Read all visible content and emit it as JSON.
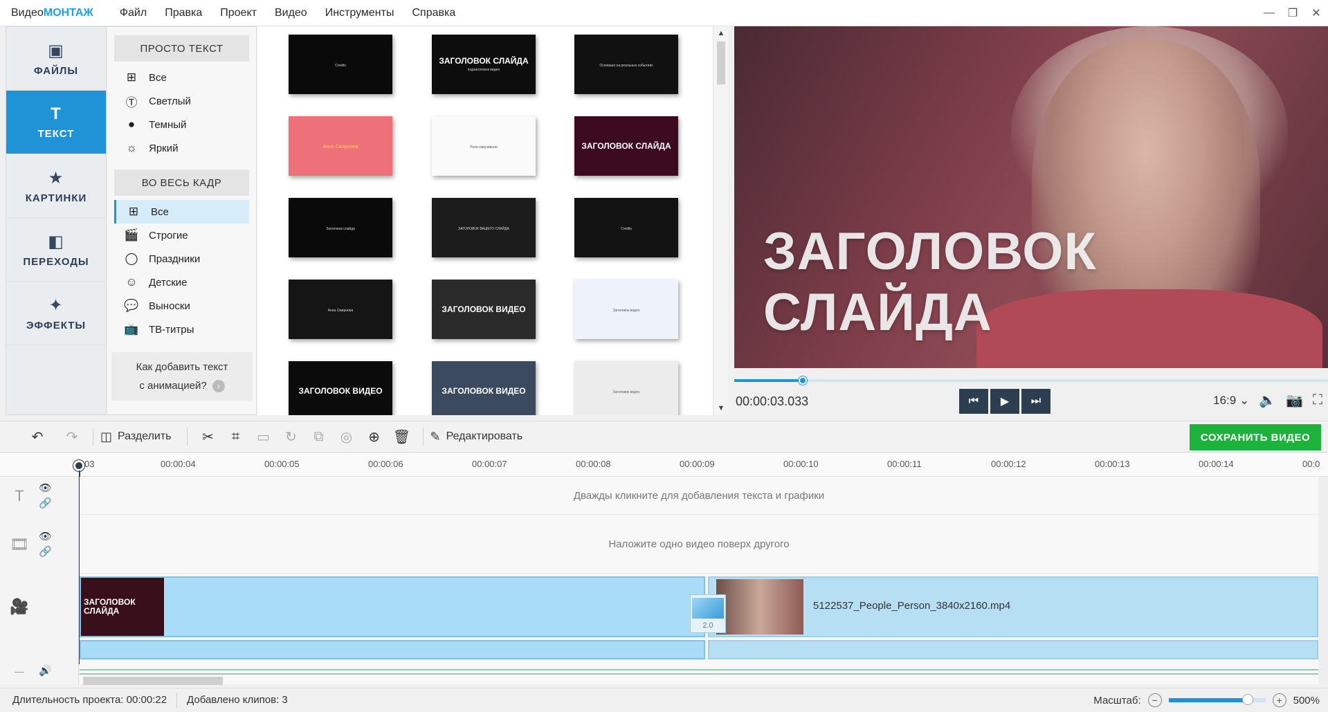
{
  "app": {
    "logo_plain": "Видео",
    "logo_bold": "МОНТАЖ"
  },
  "menu": [
    "Файл",
    "Правка",
    "Проект",
    "Видео",
    "Инструменты",
    "Справка"
  ],
  "window_controls": {
    "minimize": "—",
    "restore": "❐",
    "close": "✕"
  },
  "leftnav": [
    {
      "label": "ФАЙЛЫ",
      "icon": "image-icon",
      "glyph": "▣",
      "active": false
    },
    {
      "label": "ТЕКСТ",
      "icon": "text-icon",
      "glyph": "T",
      "active": true
    },
    {
      "label": "КАРТИНКИ",
      "icon": "star-icon",
      "glyph": "★",
      "active": false
    },
    {
      "label": "ПЕРЕХОДЫ",
      "icon": "transitions-icon",
      "glyph": "◧",
      "active": false
    },
    {
      "label": "ЭФФЕКТЫ",
      "icon": "magic-wand-icon",
      "glyph": "✦",
      "active": false
    }
  ],
  "categories": {
    "group1_title": "ПРОСТО ТЕКСТ",
    "group1": [
      {
        "label": "Все",
        "icon": "grid-icon",
        "glyph": "⊞"
      },
      {
        "label": "Светлый",
        "icon": "text-circle-light-icon",
        "glyph": "Ⓣ"
      },
      {
        "label": "Темный",
        "icon": "text-circle-dark-icon",
        "glyph": "●"
      },
      {
        "label": "Яркий",
        "icon": "sun-icon",
        "glyph": "☼"
      }
    ],
    "group2_title": "ВО ВЕСЬ КАДР",
    "group2": [
      {
        "label": "Все",
        "icon": "grid-icon",
        "glyph": "⊞",
        "selected": true
      },
      {
        "label": "Строгие",
        "icon": "clapper-icon",
        "glyph": "🎬"
      },
      {
        "label": "Праздники",
        "icon": "balloon-icon",
        "glyph": "◯"
      },
      {
        "label": "Детские",
        "icon": "smiley-icon",
        "glyph": "☺"
      },
      {
        "label": "Выноски",
        "icon": "speech-bubble-icon",
        "glyph": "💬"
      },
      {
        "label": "ТВ-титры",
        "icon": "tv-icon",
        "glyph": "📺"
      }
    ],
    "help_line1": "Как добавить текст",
    "help_line2": "с анимацией?"
  },
  "thumbnails": [
    {
      "title": "",
      "sub": "Credits",
      "bg": "#0a0a0a"
    },
    {
      "title": "ЗАГОЛОВОК СЛАЙДА",
      "sub": "подзаголовок видео",
      "bg": "#0d0d0d"
    },
    {
      "title": "",
      "sub": "Основано на реальных событиях",
      "bg": "#111111"
    },
    {
      "title": "",
      "sub": "Анна Смирнова",
      "bg": "#ee7079"
    },
    {
      "title": "",
      "sub": "Роли озвучивали",
      "bg": "#fafafa"
    },
    {
      "title": "ЗАГОЛОВОК СЛАЙДА",
      "sub": "",
      "bg": "#3c0b22"
    },
    {
      "title": "",
      "sub": "Заголовок слайда",
      "bg": "#0a0a0a"
    },
    {
      "title": "",
      "sub": "ЗАГОЛОВОК ВАШЕГО СЛАЙДА",
      "bg": "#1c1c1c"
    },
    {
      "title": "",
      "sub": "Credits",
      "bg": "#121212"
    },
    {
      "title": "",
      "sub": "Анна Смирнова",
      "bg": "#151515"
    },
    {
      "title": "ЗАГОЛОВОК ВИДЕО",
      "sub": "",
      "bg": "#2a2a2a"
    },
    {
      "title": "",
      "sub": "Заголовок видео",
      "bg": "#eef3fb"
    },
    {
      "title": "ЗАГОЛОВОК ВИДЕО",
      "sub": "",
      "bg": "#0b0b0b"
    },
    {
      "title": "ЗАГОЛОВОК ВИДЕО",
      "sub": "",
      "bg": "#3b4a5f"
    },
    {
      "title": "",
      "sub": "Заголовок видео",
      "bg": "#ececec"
    }
  ],
  "preview": {
    "title_line1": "ЗАГОЛОВОК",
    "title_line2": "СЛАЙДА",
    "time": "00:00:03.033",
    "aspect": "16:9",
    "progress": 0.115
  },
  "toolbar": {
    "split": "Разделить",
    "edit": "Редактировать",
    "save": "СОХРАНИТЬ ВИДЕО"
  },
  "ruler": [
    "03",
    "00:00:04",
    "00:00:05",
    "00:00:06",
    "00:00:07",
    "00:00:08",
    "00:00:09",
    "00:00:10",
    "00:00:11",
    "00:00:12",
    "00:00:13",
    "00:00:14",
    "00:0"
  ],
  "timeline": {
    "text_hint": "Дважды кликните для добавления текста и графики",
    "overlay_hint": "Наложите одно видео поверх другого",
    "clip1_title": "ЗАГОЛОВОК СЛАЙДА",
    "transition_duration": "2.0",
    "clip2_name": "5122537_People_Person_3840x2160.mp4"
  },
  "status": {
    "duration": "Длительность проекта:  00:00:22",
    "clips": "Добавлено клипов: 3",
    "zoom_label": "Масштаб:",
    "zoom_value": "500%",
    "zoom_level": 0.82
  },
  "colors": {
    "accent": "#1f93d6",
    "save": "#1cb23c",
    "nav_dark": "#2d3e50"
  }
}
